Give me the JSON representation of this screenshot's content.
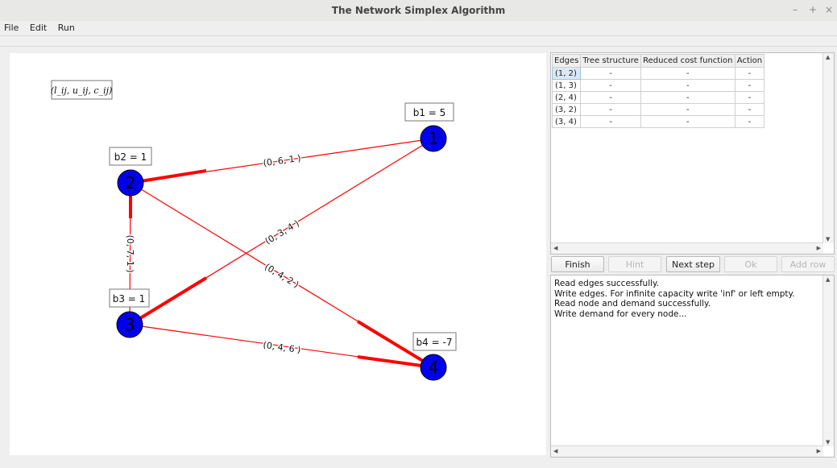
{
  "window": {
    "title": "The Network Simplex Algorithm",
    "controls": [
      "–",
      "+",
      "×"
    ]
  },
  "menu": [
    "File",
    "Edit",
    "Run"
  ],
  "legend": "(l_ij, u_ij, c_ij)",
  "nodes": [
    {
      "id": "1",
      "demand_label": "b1 = 5"
    },
    {
      "id": "2",
      "demand_label": "b2 = 1"
    },
    {
      "id": "3",
      "demand_label": "b3 = 1"
    },
    {
      "id": "4",
      "demand_label": "b4 = -7"
    }
  ],
  "edges": [
    {
      "from": "2",
      "to": "1",
      "label": "(0, 6, 1 )"
    },
    {
      "from": "3",
      "to": "1",
      "label": "(0, 3, 4 )"
    },
    {
      "from": "2",
      "to": "4",
      "label": "(0, 4, 2 )"
    },
    {
      "from": "3",
      "to": "2",
      "label": "(0, 7, 1 )"
    },
    {
      "from": "3",
      "to": "4",
      "label": "(0, 4, 6 )"
    }
  ],
  "colors": {
    "node_fill": "#0000ee",
    "edge": "#ff0000",
    "canvas": "#ffffff"
  },
  "table": {
    "headers": [
      "Edges",
      "Tree structure",
      "Reduced cost function",
      "Action"
    ],
    "rows": [
      [
        "(1, 2)",
        "-",
        "-",
        "-"
      ],
      [
        "(1, 3)",
        "-",
        "-",
        "-"
      ],
      [
        "(2, 4)",
        "-",
        "-",
        "-"
      ],
      [
        "(3, 2)",
        "-",
        "-",
        "-"
      ],
      [
        "(3, 4)",
        "-",
        "-",
        "-"
      ]
    ],
    "selected_cell": "(1, 2)"
  },
  "buttons": {
    "finish": "Finish",
    "hint": "Hint",
    "next_step": "Next step",
    "ok": "Ok",
    "add_row": "Add row"
  },
  "log": [
    "Read edges successfully.",
    "Write edges. For infinite capacity write 'inf' or left empty.",
    "Read node and demand successfully.",
    "Write demand for every node..."
  ]
}
